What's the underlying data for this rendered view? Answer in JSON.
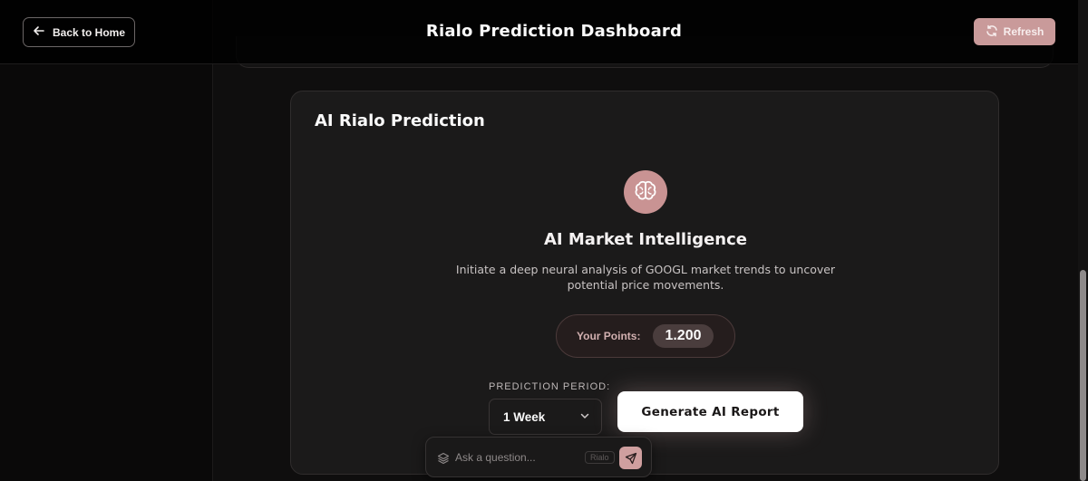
{
  "header": {
    "back_label": "Back to Home",
    "title": "Rialo Prediction Dashboard",
    "refresh_label": "Refresh"
  },
  "card": {
    "title": "AI Rialo Prediction",
    "heading": "AI Market Intelligence",
    "description": "Initiate a deep neural analysis of GOOGL market trends to uncover potential price movements.",
    "points_label": "Your Points:",
    "points_value": "1.200",
    "period_label": "PREDICTION PERIOD:",
    "period_value": "1 Week",
    "generate_label": "Generate AI Report"
  },
  "ask": {
    "placeholder": "Ask a question...",
    "tag": "Rialo"
  },
  "colors": {
    "accent": "#c99a9a",
    "background": "#0d0c0c",
    "card": "#1b1a1a"
  },
  "icons": [
    "arrow-left-icon",
    "refresh-icon",
    "brain-icon",
    "chevron-down-icon",
    "layers-icon",
    "send-icon"
  ]
}
